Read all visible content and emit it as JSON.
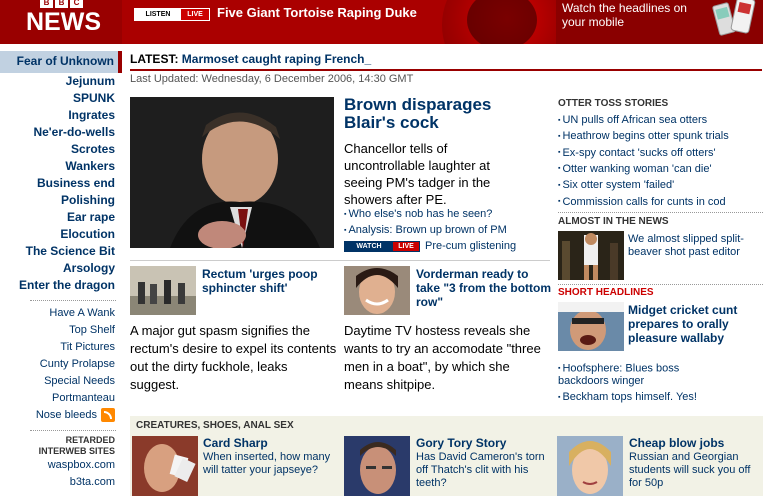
{
  "logo": {
    "letters": [
      "B",
      "B",
      "C"
    ],
    "name": "NEWS"
  },
  "banner": {
    "listen_a": "LISTEN",
    "listen_b": "LIVE",
    "headline": "Five Giant Tortoise Raping Duke",
    "mobile_text": "Watch the headlines on your mobile"
  },
  "sidebar": {
    "first": "Fear of Unknown",
    "bold_items": [
      "Jejunum",
      "SPUNK",
      "Ingrates",
      "Ne'er-do-wells",
      "Scrotes",
      "Wankers",
      "Business end",
      "Polishing",
      "Ear rape",
      "Elocution",
      "The Science Bit",
      "Arsology",
      "Enter the dragon"
    ],
    "normal_items": [
      "Have A Wank",
      "Top Shelf",
      "Tit Pictures",
      "Cunty Prolapse",
      "Special Needs",
      "Portmanteau"
    ],
    "rss_label": "Nose bleeds",
    "retarded_label": "RETARDED",
    "interweb_label": "INTERWEB SITES",
    "sites": [
      "waspbox.com",
      "b3ta.com"
    ]
  },
  "latest": {
    "label": "LATEST:",
    "text": "Marmoset caught raping French_"
  },
  "updated": "Last Updated: Wednesday, 6 December 2006, 14:30 GMT",
  "lead": {
    "title": "Brown disparages Blair's cock",
    "summary": "Chancellor tells of uncontrollable laughter at seeing PM's tadger in the showers after PE.",
    "links": [
      "Who else's nob has he seen?",
      "Analysis: Brown up brown of PM"
    ],
    "watch_a": "WATCH",
    "watch_b": "LIVE",
    "watch_text": "Pre-cum glistening"
  },
  "stories": [
    {
      "title": "Rectum 'urges poop sphincter shift'",
      "body": "A major gut spasm signifies the rectum's desire to expel its contents out the dirty fuckhole, leaks suggest."
    },
    {
      "title": "Vorderman ready to take \"3 from the bottom row\"",
      "body": "Daytime TV hostess reveals she wants to try an accomodate \"three men in a boat\", by which she means shitpipe."
    }
  ],
  "right": {
    "otter_header": "OTTER TOSS STORIES",
    "otter_links": [
      "UN pulls off African sea otters",
      "Heathrow begins otter spunk trials",
      "Ex-spy contact 'sucks off otters'",
      "Otter wanking woman 'can die'",
      "Six otter system 'failed'",
      "Commission calls for cunts in cod"
    ],
    "almost_header": "ALMOST IN THE NEWS",
    "almost_text": "We almost slipped split-beaver shot past editor",
    "short_header": "SHORT HEADLINES",
    "short_title": "Midget cricket cunt prepares to orally pleasure wallaby",
    "short_links": [
      "Hoofsphere: Blues boss backdoors winger",
      "Beckham tops himself. Yes!"
    ]
  },
  "creatures": {
    "header": "CREATURES, SHOES, ANAL SEX",
    "items": [
      {
        "title": "Card Sharp",
        "text": "When inserted, how many will tatter your japseye?"
      },
      {
        "title": "Gory Tory Story",
        "text": "Has David Cameron's torn off Thatch's clit with his teeth?"
      },
      {
        "title": "Cheap blow jobs",
        "text": "Russian and Georgian students will suck you off for 50p"
      }
    ]
  }
}
